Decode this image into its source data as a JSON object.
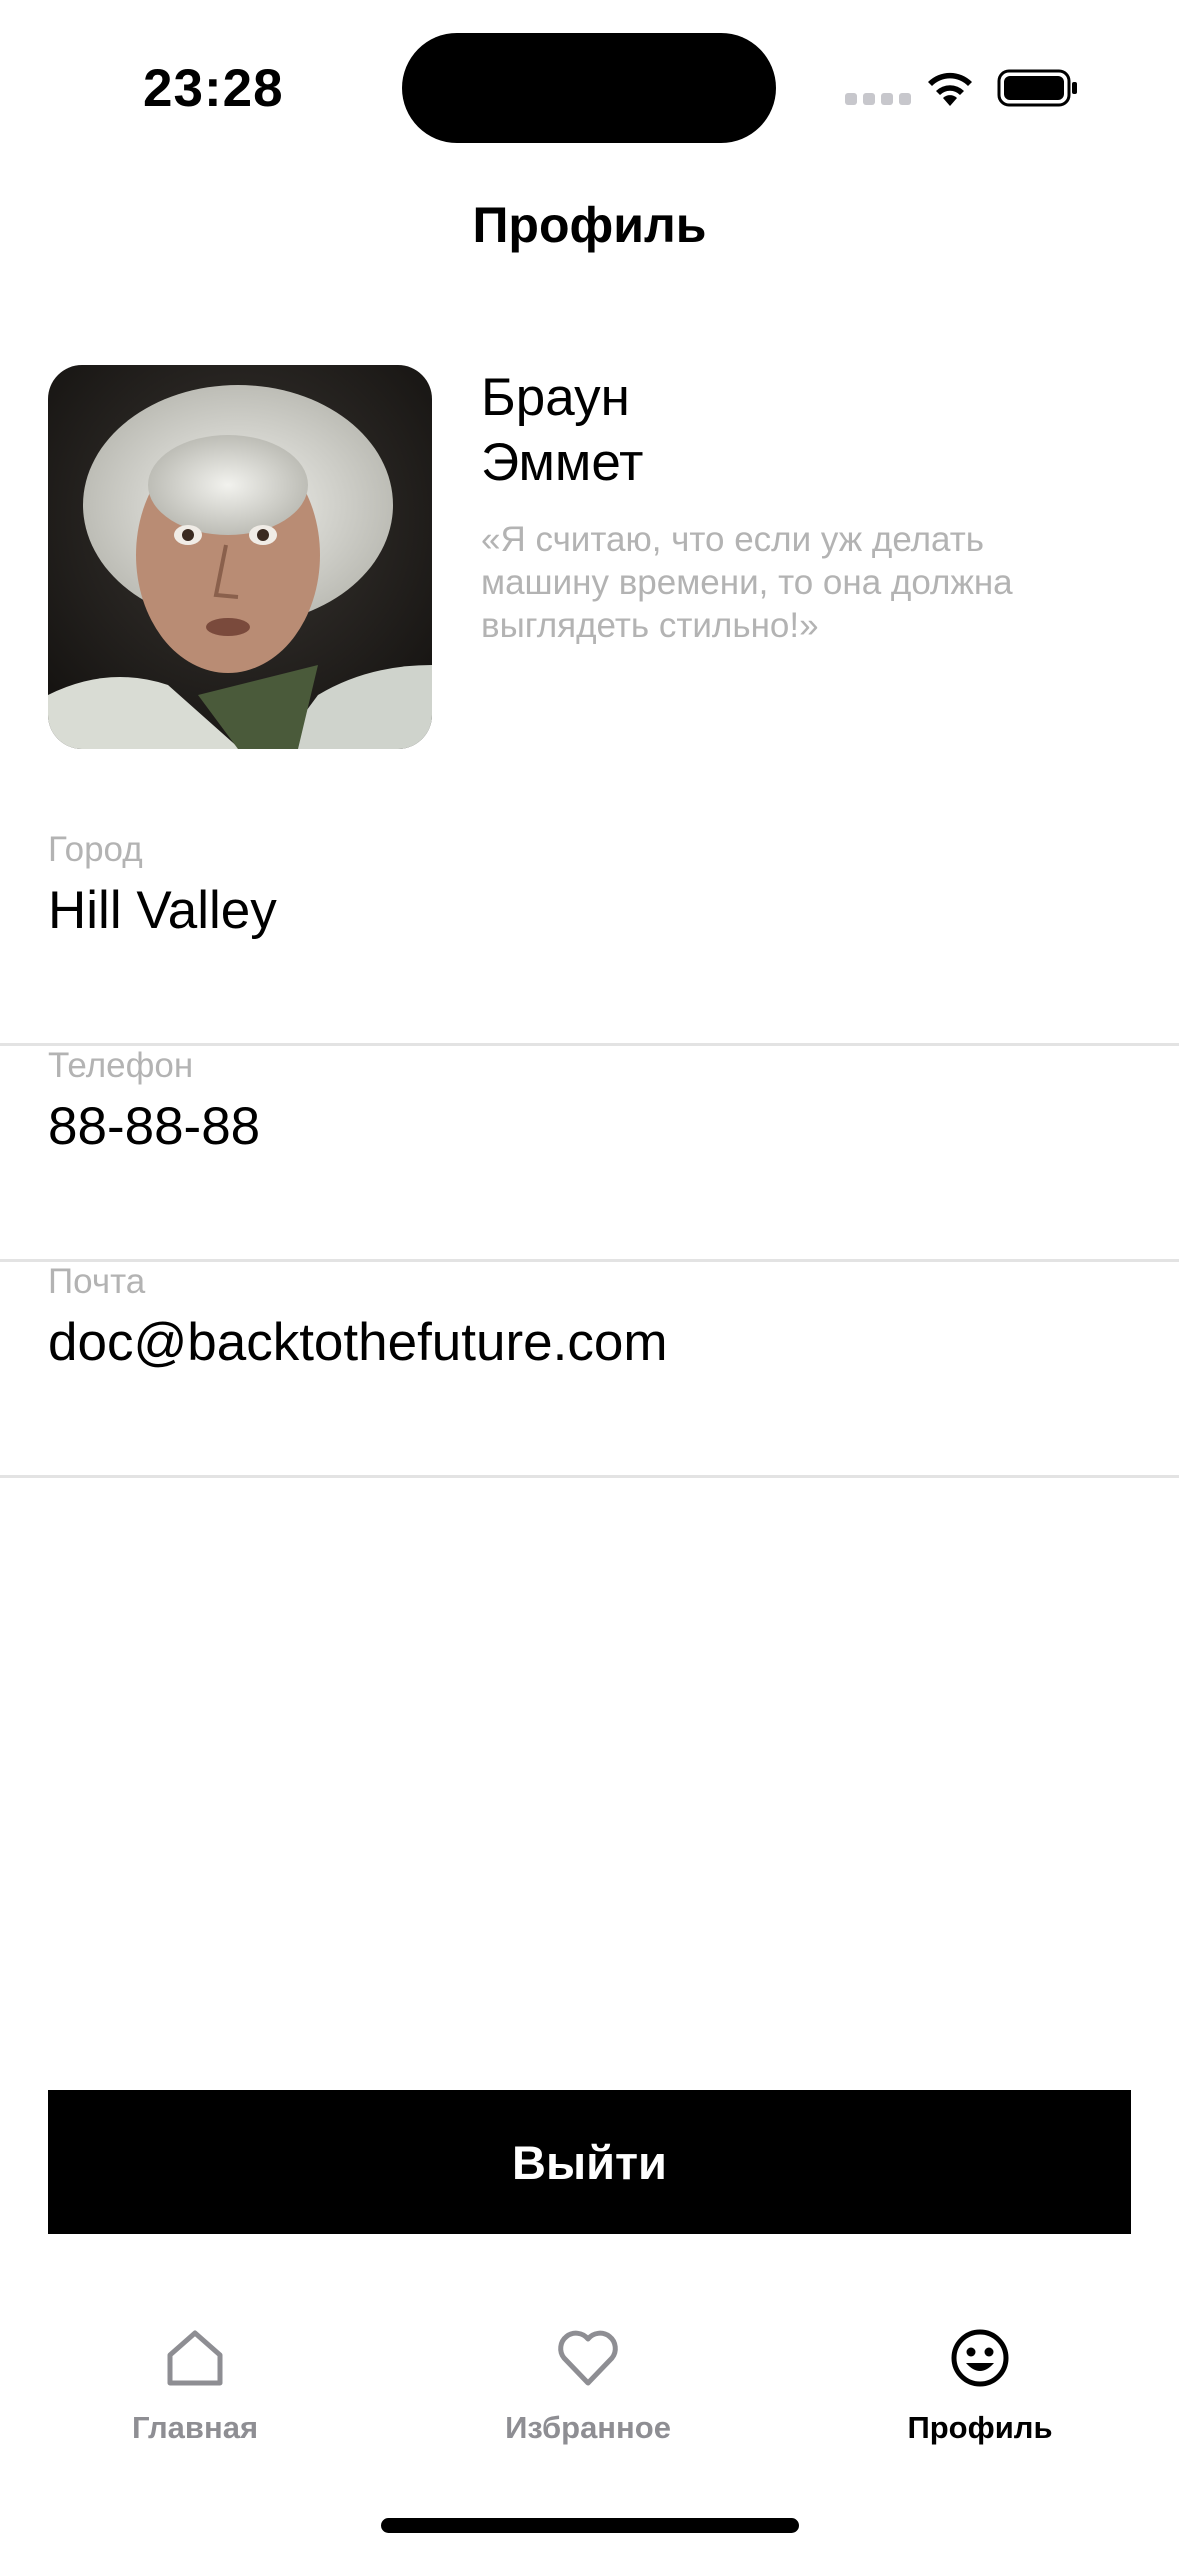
{
  "status_bar": {
    "time": "23:28"
  },
  "header": {
    "title": "Профиль"
  },
  "profile": {
    "last_name": "Браун",
    "first_name": "Эммет",
    "quote": "«Я считаю, что если уж делать машину времени, то она должна выглядеть стильно!»",
    "avatar_description": "avatar-photo"
  },
  "info": [
    {
      "label": "Город",
      "value": "Hill Valley"
    },
    {
      "label": "Телефон",
      "value": "88-88-88"
    },
    {
      "label": "Почта",
      "value": "doc@backtothefuture.com"
    }
  ],
  "actions": {
    "logout_label": "Выйти"
  },
  "tab_bar": {
    "items": [
      {
        "label": "Главная",
        "icon": "home-icon",
        "active": false
      },
      {
        "label": "Избранное",
        "icon": "heart-icon",
        "active": false
      },
      {
        "label": "Профиль",
        "icon": "smiley-icon",
        "active": true
      }
    ]
  },
  "colors": {
    "accent": "#000000",
    "secondary_text": "#b3b3b3",
    "inactive_tab": "#8e8e93",
    "divider": "#e3e3e3"
  }
}
